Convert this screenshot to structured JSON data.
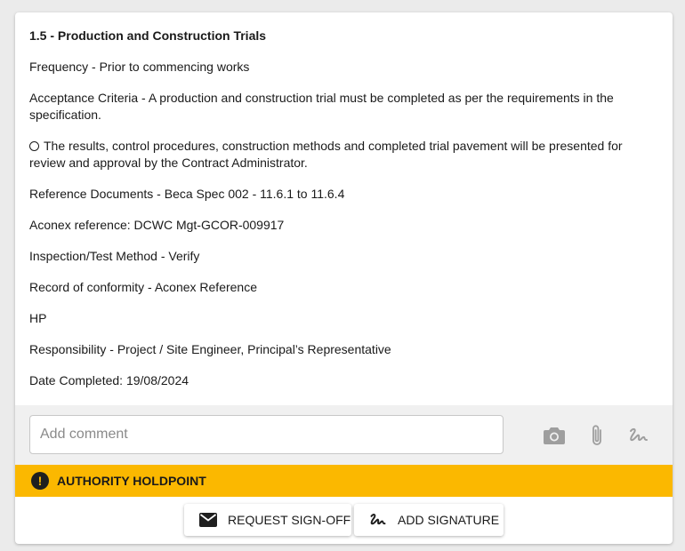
{
  "item": {
    "title": "1.5 - Production and Construction Trials",
    "frequency": "Frequency - Prior to commencing works",
    "acceptance": "Acceptance Criteria - A production and construction trial must be completed as per the requirements in the specification.",
    "results": "The results, control procedures, construction methods and completed trial pavement will be presented for review and approval by the Contract Administrator.",
    "reference_docs": "Reference Documents - Beca Spec 002 - 11.6.1 to 11.6.4",
    "aconex_ref": "Aconex reference: DCWC Mgt-GCOR-009917",
    "method": "Inspection/Test Method - Verify",
    "conformity": "Record of conformity - Aconex Reference",
    "hp": "HP",
    "responsibility": "Responsibility - Project / Site Engineer, Principal’s Representative",
    "date_completed": "Date Completed: 19/08/2024"
  },
  "comment": {
    "placeholder": "Add comment",
    "value": "",
    "icons": [
      "camera-icon",
      "paperclip-icon",
      "signature-icon"
    ]
  },
  "holdpoint": {
    "label": "AUTHORITY HOLDPOINT",
    "icon": "exclamation-icon",
    "color": "#fbb800"
  },
  "actions": {
    "request_signoff": "REQUEST SIGN-OFF",
    "add_signature": "ADD SIGNATURE"
  }
}
